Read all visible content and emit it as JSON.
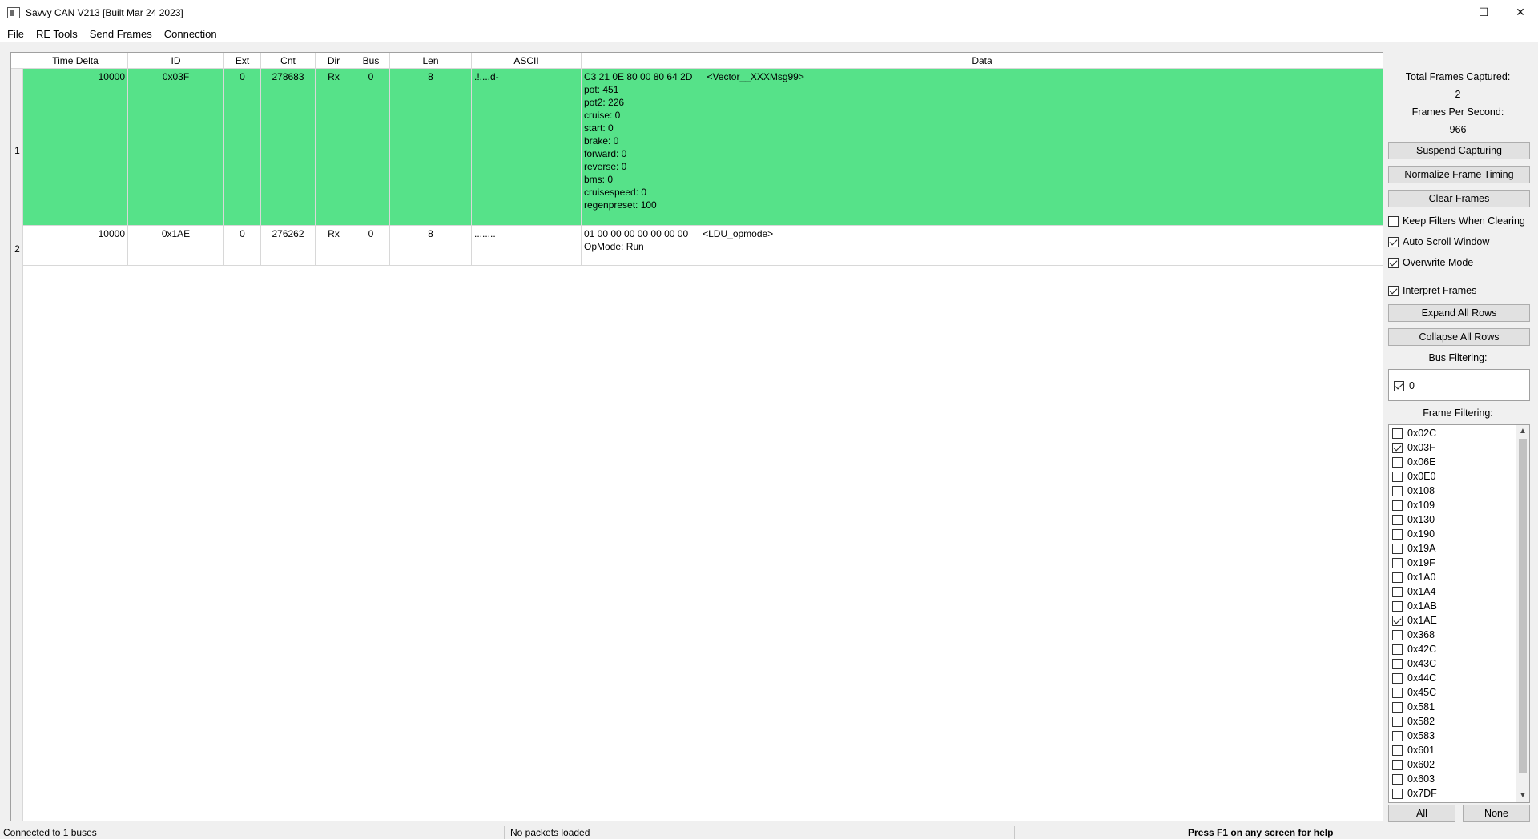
{
  "window": {
    "title": "Savvy CAN V213 [Built Mar 24 2023]",
    "controls": {
      "minimize": "—",
      "maximize": "☐",
      "close": "✕"
    }
  },
  "menu": [
    "File",
    "RE Tools",
    "Send Frames",
    "Connection"
  ],
  "table": {
    "columns": [
      "Time Delta",
      "ID",
      "Ext",
      "Cnt",
      "Dir",
      "Bus",
      "Len",
      "ASCII",
      "Data"
    ],
    "rows": [
      {
        "num": "1",
        "time_delta": "10000",
        "id": "0x03F",
        "ext": "0",
        "cnt": "278683",
        "dir": "Rx",
        "bus": "0",
        "len": "8",
        "ascii": ".!....d-",
        "data_hex": "C3 21 0E 80 00 80 64 2D",
        "data_msg": "<Vector__XXXMsg99>",
        "signals": [
          "pot: 451",
          "pot2: 226",
          "cruise: 0",
          "start: 0",
          "brake: 0",
          "forward: 0",
          "reverse: 0",
          "bms: 0",
          "cruisespeed: 0",
          "regenpreset: 100"
        ],
        "highlight_color": "#56e289"
      },
      {
        "num": "2",
        "time_delta": "10000",
        "id": "0x1AE",
        "ext": "0",
        "cnt": "276262",
        "dir": "Rx",
        "bus": "0",
        "len": "8",
        "ascii": "........",
        "data_hex": "01 00 00 00 00 00 00 00",
        "data_msg": "<LDU_opmode>",
        "signals": [
          "OpMode: Run"
        ]
      }
    ]
  },
  "panel": {
    "total_frames_label": "Total Frames Captured:",
    "total_frames_value": "2",
    "fps_label": "Frames Per Second:",
    "fps_value": "966",
    "suspend_button": "Suspend Capturing",
    "normalize_button": "Normalize Frame Timing",
    "clear_button": "Clear Frames",
    "keep_filters": {
      "label": "Keep Filters When Clearing",
      "checked": false
    },
    "auto_scroll": {
      "label": "Auto Scroll Window",
      "checked": true
    },
    "overwrite": {
      "label": "Overwrite Mode",
      "checked": true
    },
    "interpret": {
      "label": "Interpret Frames",
      "checked": true
    },
    "expand_button": "Expand All Rows",
    "collapse_button": "Collapse All Rows",
    "bus_filter_label": "Bus Filtering:",
    "bus_filter": {
      "label": "0",
      "checked": true
    },
    "frame_filter_label": "Frame Filtering:",
    "frame_filters": [
      {
        "id": "0x02C",
        "checked": false
      },
      {
        "id": "0x03F",
        "checked": true
      },
      {
        "id": "0x06E",
        "checked": false
      },
      {
        "id": "0x0E0",
        "checked": false
      },
      {
        "id": "0x108",
        "checked": false
      },
      {
        "id": "0x109",
        "checked": false
      },
      {
        "id": "0x130",
        "checked": false
      },
      {
        "id": "0x190",
        "checked": false
      },
      {
        "id": "0x19A",
        "checked": false
      },
      {
        "id": "0x19F",
        "checked": false
      },
      {
        "id": "0x1A0",
        "checked": false
      },
      {
        "id": "0x1A4",
        "checked": false
      },
      {
        "id": "0x1AB",
        "checked": false
      },
      {
        "id": "0x1AE",
        "checked": true
      },
      {
        "id": "0x368",
        "checked": false
      },
      {
        "id": "0x42C",
        "checked": false
      },
      {
        "id": "0x43C",
        "checked": false
      },
      {
        "id": "0x44C",
        "checked": false
      },
      {
        "id": "0x45C",
        "checked": false
      },
      {
        "id": "0x581",
        "checked": false
      },
      {
        "id": "0x582",
        "checked": false
      },
      {
        "id": "0x583",
        "checked": false
      },
      {
        "id": "0x601",
        "checked": false
      },
      {
        "id": "0x602",
        "checked": false
      },
      {
        "id": "0x603",
        "checked": false
      },
      {
        "id": "0x7DF",
        "checked": false
      }
    ],
    "all_button": "All",
    "none_button": "None"
  },
  "status": {
    "connection": "Connected to 1 buses",
    "packets": "No packets loaded",
    "help": "Press F1 on any screen for help"
  }
}
